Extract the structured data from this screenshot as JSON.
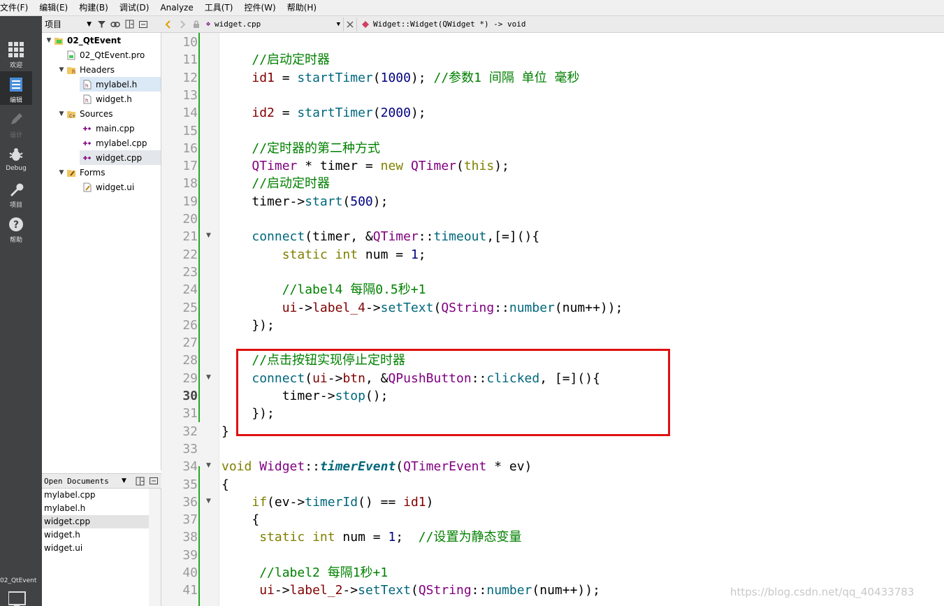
{
  "menu": [
    "文件(F)",
    "编辑(E)",
    "构建(B)",
    "调试(D)",
    "Analyze",
    "工具(T)",
    "控件(W)",
    "帮助(H)"
  ],
  "modes": [
    {
      "name": "welcome",
      "label": "欢迎",
      "icon": "grid-icon",
      "active": false
    },
    {
      "name": "edit",
      "label": "编辑",
      "icon": "document-icon",
      "active": true
    },
    {
      "name": "design",
      "label": "设计",
      "icon": "pencil-icon",
      "active": false
    },
    {
      "name": "debug",
      "label": "Debug",
      "icon": "bug-icon",
      "active": false
    },
    {
      "name": "projects",
      "label": "项目",
      "icon": "wrench-icon",
      "active": false
    },
    {
      "name": "help",
      "label": "帮助",
      "icon": "help-icon",
      "active": false
    }
  ],
  "kit": "02_QtEvent",
  "project_pane": {
    "combo_label": "项目",
    "tree": [
      {
        "label": "02_QtEvent",
        "depth": 0,
        "expanded": true,
        "icon": "qt-project-icon",
        "bold": true
      },
      {
        "label": "02_QtEvent.pro",
        "depth": 1,
        "icon": "pro-file-icon"
      },
      {
        "label": "Headers",
        "depth": 1,
        "expanded": true,
        "icon": "headers-folder-icon"
      },
      {
        "label": "mylabel.h",
        "depth": 2,
        "icon": "header-file-icon",
        "state": "current"
      },
      {
        "label": "widget.h",
        "depth": 2,
        "icon": "header-file-icon"
      },
      {
        "label": "Sources",
        "depth": 1,
        "expanded": true,
        "icon": "sources-folder-icon"
      },
      {
        "label": "main.cpp",
        "depth": 2,
        "icon": "cpp-file-icon"
      },
      {
        "label": "mylabel.cpp",
        "depth": 2,
        "icon": "cpp-file-icon"
      },
      {
        "label": "widget.cpp",
        "depth": 2,
        "icon": "cpp-file-icon",
        "state": "selected"
      },
      {
        "label": "Forms",
        "depth": 1,
        "expanded": true,
        "icon": "forms-folder-icon"
      },
      {
        "label": "widget.ui",
        "depth": 2,
        "icon": "ui-file-icon"
      }
    ]
  },
  "open_documents": {
    "title": "Open Documents",
    "items": [
      "mylabel.cpp",
      "mylabel.h",
      "widget.cpp",
      "widget.h",
      "widget.ui"
    ],
    "selected": "widget.cpp"
  },
  "editor": {
    "file_name": "widget.cpp",
    "symbol": "Widget::Widget(QWidget *) -> void",
    "current_line": "30",
    "lines": [
      {
        "n": "10",
        "html": ""
      },
      {
        "n": "11",
        "html": "    <span class=\"c-cm\">//启动定时器</span>"
      },
      {
        "n": "12",
        "html": "    <span class=\"c-mem\">id1</span> = <span class=\"c-fn\">startTimer</span>(<span class=\"c-num\">1000</span>); <span class=\"c-cm\">//参数1 间隔 单位 毫秒</span>"
      },
      {
        "n": "13",
        "html": ""
      },
      {
        "n": "14",
        "html": "    <span class=\"c-mem\">id2</span> = <span class=\"c-fn\">startTimer</span>(<span class=\"c-num\">2000</span>);"
      },
      {
        "n": "15",
        "html": ""
      },
      {
        "n": "16",
        "html": "    <span class=\"c-cm\">//定时器的第二种方式</span>"
      },
      {
        "n": "17",
        "html": "    <span class=\"c-ty\">QTimer</span> * timer = <span class=\"c-kw\">new</span> <span class=\"c-ty\">QTimer</span>(<span class=\"c-kw\">this</span>);"
      },
      {
        "n": "18",
        "html": "    <span class=\"c-cm\">//启动定时器</span>"
      },
      {
        "n": "19",
        "html": "    timer-><span class=\"c-fn\">start</span>(<span class=\"c-num\">500</span>);"
      },
      {
        "n": "20",
        "html": ""
      },
      {
        "n": "21",
        "html": "    <span class=\"c-fn\">connect</span>(timer, &amp;<span class=\"c-ty\">QTimer</span>::<span class=\"c-fn\">timeout</span>,[=](){",
        "fold": true
      },
      {
        "n": "22",
        "html": "        <span class=\"c-kw\">static</span> <span class=\"c-kw\">int</span> num = <span class=\"c-num\">1</span>;"
      },
      {
        "n": "23",
        "html": ""
      },
      {
        "n": "24",
        "html": "        <span class=\"c-cm\">//label4 每隔0.5秒+1</span>"
      },
      {
        "n": "25",
        "html": "        <span class=\"c-mem\">ui</span>-><span class=\"c-mem\">label_4</span>-><span class=\"c-fn\">setText</span>(<span class=\"c-ty\">QString</span>::<span class=\"c-fn\">number</span>(num++));"
      },
      {
        "n": "26",
        "html": "    });"
      },
      {
        "n": "27",
        "html": ""
      },
      {
        "n": "28",
        "html": "    <span class=\"c-cm\">//点击按钮实现停止定时器</span>"
      },
      {
        "n": "29",
        "html": "    <span class=\"c-fn\">connect</span>(<span class=\"c-mem\">ui</span>-><span class=\"c-mem\">btn</span>, &amp;<span class=\"c-ty\">QPushButton</span>::<span class=\"c-fn\">clicked</span>, [=](){",
        "fold": true
      },
      {
        "n": "30",
        "html": "        timer-><span class=\"c-fn\">stop</span>();"
      },
      {
        "n": "31",
        "html": "    });"
      },
      {
        "n": "32",
        "html": "}"
      },
      {
        "n": "33",
        "html": ""
      },
      {
        "n": "34",
        "html": "<span class=\"c-kw\">void</span> <span class=\"c-ty\">Widget</span>::<span class=\"c-it\">timerEvent</span>(<span class=\"c-ty\">QTimerEvent</span> * ev)",
        "fold": true
      },
      {
        "n": "35",
        "html": "{"
      },
      {
        "n": "36",
        "html": "    <span class=\"c-kw\">if</span>(ev-><span class=\"c-fn\">timerId</span>() == <span class=\"c-mem\">id1</span>)",
        "fold": true
      },
      {
        "n": "37",
        "html": "    {"
      },
      {
        "n": "38",
        "html": "     <span class=\"c-kw\">static</span> <span class=\"c-kw\">int</span> num = <span class=\"c-num\">1</span>;  <span class=\"c-cm\">//设置为静态变量</span>"
      },
      {
        "n": "39",
        "html": ""
      },
      {
        "n": "40",
        "html": "     <span class=\"c-cm\">//label2 每隔1秒+1</span>"
      },
      {
        "n": "41",
        "html": "     <span class=\"c-mem\">ui</span>-><span class=\"c-mem\">label_2</span>-><span class=\"c-fn\">setText</span>(<span class=\"c-ty\">QString</span>::<span class=\"c-fn\">number</span>(num++));"
      }
    ]
  },
  "watermark": "https://blog.csdn.net/qq_40433783"
}
